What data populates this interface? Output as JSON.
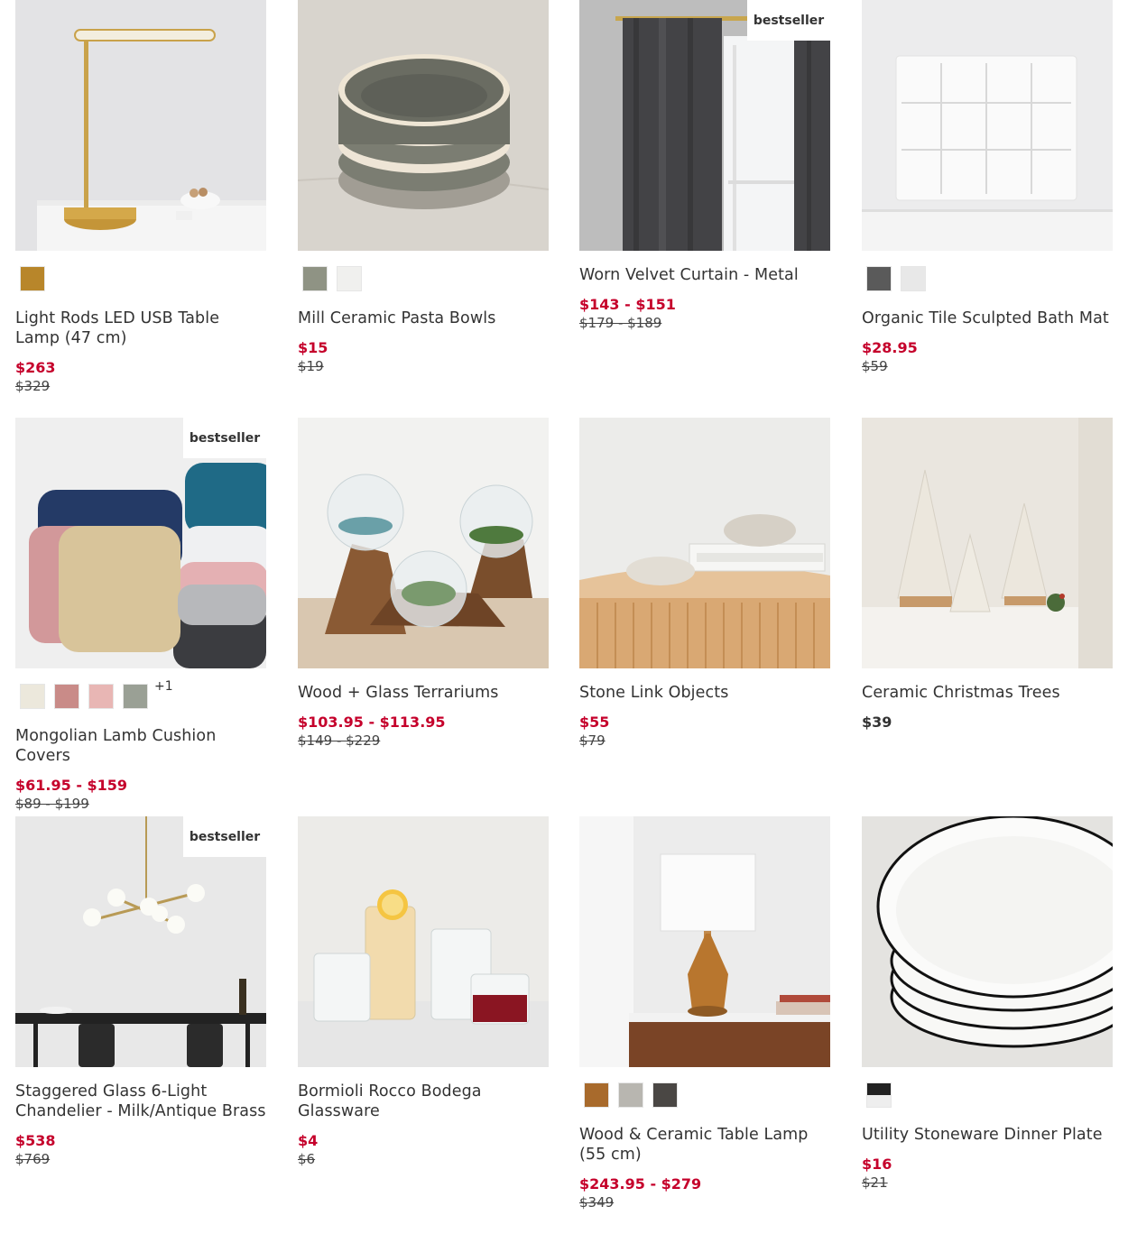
{
  "products": [
    {
      "name": "Light Rods LED USB Table Lamp (47 cm)",
      "price": "$263",
      "original_price": "$329",
      "badge": "",
      "swatches": [
        "#b8862a"
      ],
      "more_swatches": ""
    },
    {
      "name": "Mill Ceramic Pasta Bowls",
      "price": "$15",
      "original_price": "$19",
      "badge": "",
      "swatches": [
        "#8f9384",
        "#f0f0ee"
      ],
      "more_swatches": ""
    },
    {
      "name": "Worn Velvet Curtain - Metal",
      "price": "$143 - $151",
      "original_price": "$179 - $189",
      "badge": "bestseller",
      "swatches": [],
      "more_swatches": ""
    },
    {
      "name": "Organic Tile Sculpted Bath Mat",
      "price": "$28.95",
      "original_price": "$59",
      "badge": "",
      "swatches": [
        "#5a5a5a",
        "#e8e8e8"
      ],
      "more_swatches": ""
    },
    {
      "name": "Mongolian Lamb Cushion Covers",
      "price": "$61.95 - $159",
      "original_price": "$89 - $199",
      "badge": "bestseller",
      "swatches": [
        "#ece8dc",
        "#c98b88",
        "#e8b6b4",
        "#9aa095"
      ],
      "more_swatches": "+1"
    },
    {
      "name": "Wood + Glass Terrariums",
      "price": "$103.95 - $113.95",
      "original_price": "$149 - $229",
      "badge": "",
      "swatches": [],
      "more_swatches": ""
    },
    {
      "name": "Stone Link Objects",
      "price": "$55",
      "original_price": "$79",
      "badge": "",
      "swatches": [],
      "more_swatches": ""
    },
    {
      "name": "Ceramic Christmas Trees",
      "price": "$39",
      "original_price": "",
      "badge": "",
      "swatches": [],
      "more_swatches": ""
    },
    {
      "name": "Staggered Glass 6-Light Chandelier - Milk/Antique Brass",
      "price": "$538",
      "original_price": "$769",
      "badge": "bestseller",
      "swatches": [],
      "more_swatches": ""
    },
    {
      "name": "Bormioli Rocco Bodega Glassware",
      "price": "$4",
      "original_price": "$6",
      "badge": "",
      "swatches": [],
      "more_swatches": ""
    },
    {
      "name": "Wood & Ceramic Table Lamp (55 cm)",
      "price": "$243.95 - $279",
      "original_price": "$349",
      "badge": "",
      "swatches": [
        "#a86a2c",
        "#b8b6b0",
        "#4a4744"
      ],
      "more_swatches": ""
    },
    {
      "name": "Utility Stoneware Dinner Plate",
      "price": "$16",
      "original_price": "$21",
      "badge": "",
      "swatches": [
        "#222222"
      ],
      "more_swatches": ""
    }
  ],
  "colors": {
    "sale_price": "#c5002b",
    "text": "#333333",
    "background": "#ffffff"
  }
}
